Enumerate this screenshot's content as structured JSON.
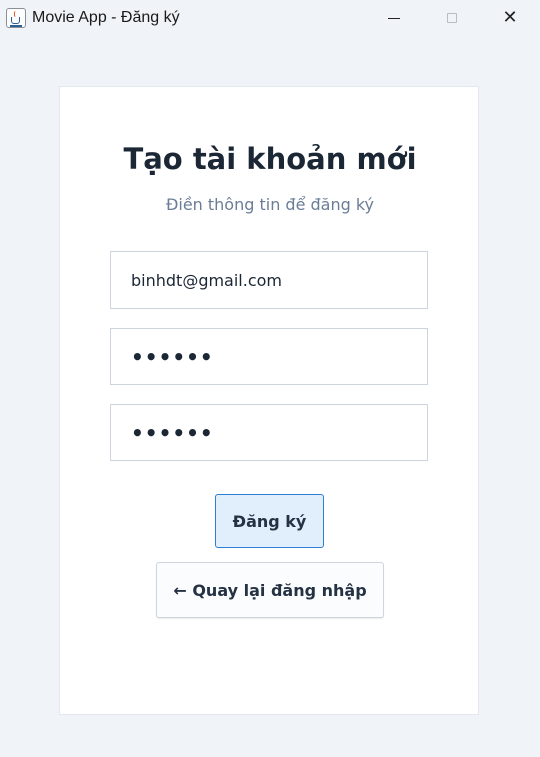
{
  "window": {
    "title": "Movie App - Đăng ký",
    "icon": "java-cup-icon",
    "controls": {
      "minimize": "minimize-icon",
      "maximize": "maximize-icon",
      "close": "close-icon",
      "close_glyph": "✕"
    }
  },
  "form": {
    "heading": "Tạo tài khoản mới",
    "subheading": "Điền thông tin để đăng ký",
    "email_value": "binhdt@gmail.com",
    "password_value": "••••••",
    "confirm_password_value": "••••••",
    "register_label": "Đăng ký",
    "back_label": "← Quay lại đăng nhập"
  },
  "colors": {
    "background": "#f0f3f8",
    "card": "#ffffff",
    "heading": "#1c2736",
    "subheading": "#6a7d96",
    "primary_border": "#2f7fd0",
    "primary_fill": "#e1eefb"
  }
}
